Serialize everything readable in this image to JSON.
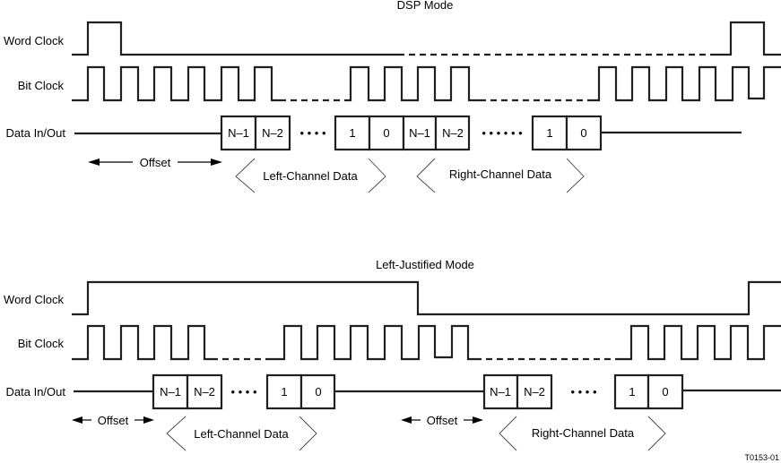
{
  "diagram": {
    "figure_id": "T0153-01",
    "panels": [
      {
        "title": "DSP Mode",
        "signals": {
          "word_clock": "Word Clock",
          "bit_clock": "Bit Clock",
          "data": "Data In/Out"
        },
        "offset_label": "Offset",
        "left_cells": [
          "N–1",
          "N–2",
          "1",
          "0"
        ],
        "right_cells": [
          "N–1",
          "N–2",
          "1",
          "0"
        ],
        "left_channel_label": "Left-Channel Data",
        "right_channel_label": "Right-Channel Data",
        "left_ellipsis": "• • • •",
        "right_ellipsis": "• • • • • •"
      },
      {
        "title": "Left-Justified Mode",
        "signals": {
          "word_clock": "Word Clock",
          "bit_clock": "Bit Clock",
          "data": "Data In/Out"
        },
        "offset_label_left": "Offset",
        "offset_label_right": "Offset",
        "left_cells": [
          "N–1",
          "N–2",
          "1",
          "0"
        ],
        "right_cells": [
          "N–1",
          "N–2",
          "1",
          "0"
        ],
        "left_channel_label": "Left-Channel Data",
        "right_channel_label": "Right-Channel Data",
        "left_ellipsis": "• • • •",
        "right_ellipsis": "• • • •"
      }
    ]
  }
}
